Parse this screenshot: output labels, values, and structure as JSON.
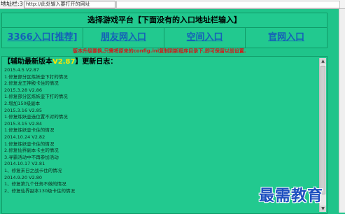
{
  "address_bar": {
    "label": "地址栏:3",
    "value": "http://此处输入要打开的网址"
  },
  "portal": {
    "title": "选择游戏平台【下面没有的入口地址栏输入】",
    "links": [
      "3366入口[推荐]",
      "朋友网入口",
      "空间入口",
      "官网入口"
    ]
  },
  "notice": "版本升级要换,只需将原来的config.ini复制到新程序目录下,即可保留以前设置.",
  "log": {
    "header_prefix": "【辅助最新版本",
    "header_version": "V2.87",
    "header_suffix": "】更新日志：",
    "lines": [
      "2015.4.5 V2.87",
      "1.修复部分区炼妖壶下打的情况",
      "2.修复龙王神殿卡住的情况",
      "2015.3.28 V2.86",
      "1.修复部分区炼妖壶下打的情况",
      "2.增加150级副本",
      "2015.3.16 V2.85",
      "1.修复炼妖壶选位置不对的情况",
      "2015.3.15 V2.84",
      "1.修复炼妖壶卡住的情况",
      "2014.10.24 V2.82",
      "1.修复炼妖壶卡住的情况",
      "2.修复仙界副本卡主的情况",
      "3.寻霸活动中不再参加活动",
      "2014.10.17 V2.81",
      "1、修复末日之战卡住的情况",
      "2014.9.20 V2.80",
      "1、修复第九个任务不做的情况",
      "2、修复仙界副本130级卡住的情况"
    ]
  },
  "watermark": "最需教育"
}
